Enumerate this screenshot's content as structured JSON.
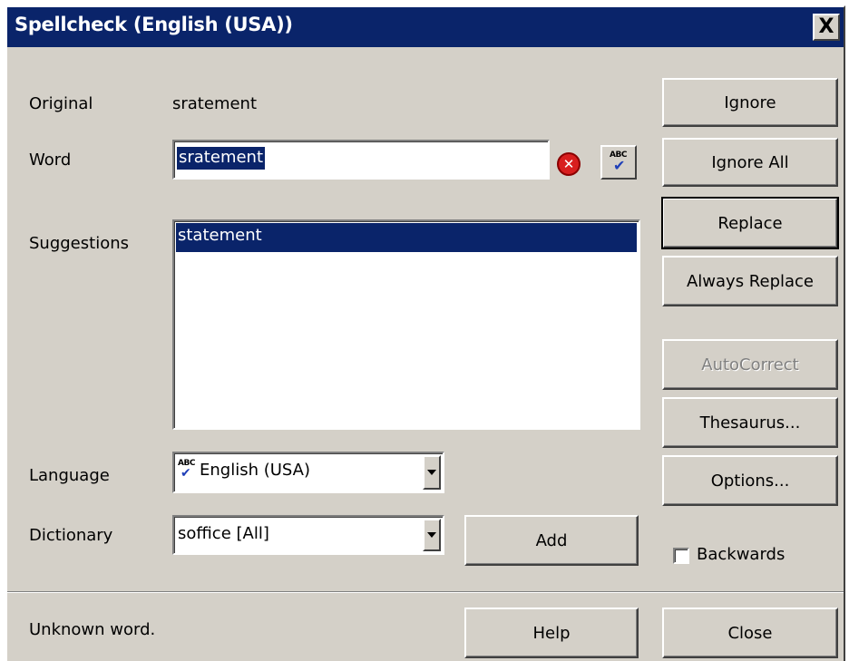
{
  "window": {
    "title": "Spellcheck (English (USA))",
    "close_glyph": "X"
  },
  "labels": {
    "original": "Original",
    "word": "Word",
    "suggestions": "Suggestions",
    "language": "Language",
    "dictionary": "Dictionary"
  },
  "original_value": "sratement",
  "word_value": "sratement",
  "suggestions": [
    "statement"
  ],
  "language": {
    "selected": "English (USA)",
    "icon_text": "ABC"
  },
  "dictionary": {
    "selected": "soffice [All]"
  },
  "icons": {
    "error": "error-x-icon",
    "spellcheck": "abc-check-icon",
    "error_glyph": "✕",
    "abc_glyph": "ABC"
  },
  "buttons": {
    "ignore": "Ignore",
    "ignore_all": "Ignore All",
    "replace": "Replace",
    "always_replace": "Always Replace",
    "autocorrect": "AutoCorrect",
    "thesaurus": "Thesaurus...",
    "options": "Options...",
    "add": "Add",
    "help": "Help",
    "close": "Close"
  },
  "backwards": {
    "label": "Backwards",
    "checked": false
  },
  "status": "Unknown word.",
  "colors": {
    "titlebar": "#0a246a",
    "face": "#d4d0c8",
    "selection": "#0a246a",
    "error_red": "#d81e1e"
  }
}
